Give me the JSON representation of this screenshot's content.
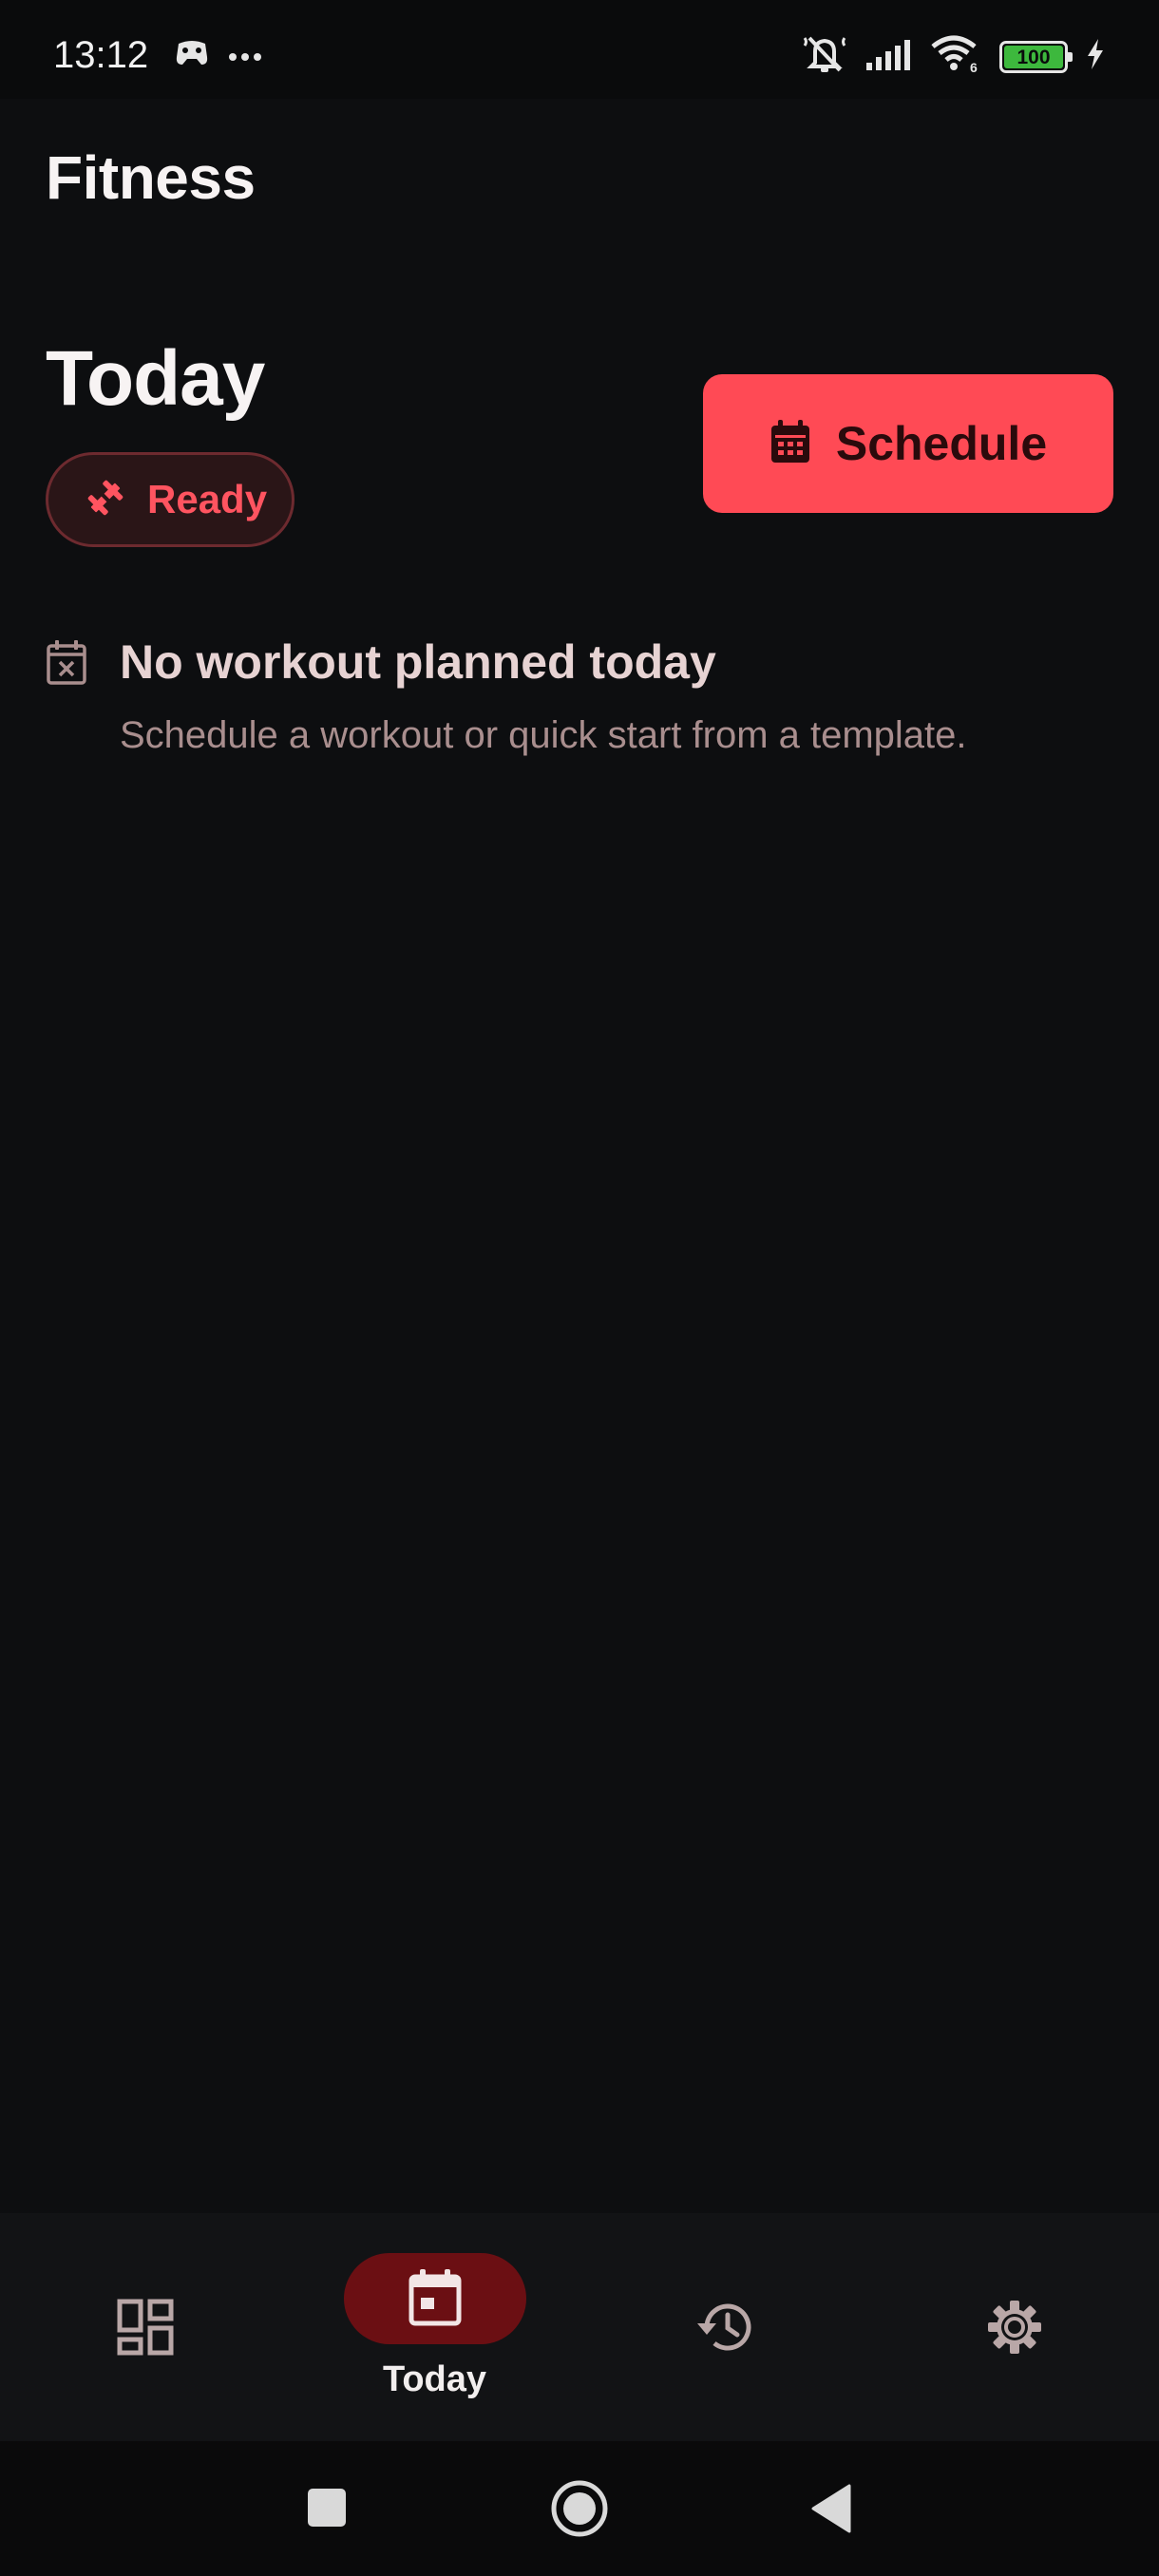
{
  "status_bar": {
    "time": "13:12",
    "battery_level": "100",
    "left_icons": [
      "game-controller-icon",
      "more-dots-icon"
    ],
    "right_icons": [
      "notifications-muted-icon",
      "cellular-signal-icon",
      "wifi-6-icon",
      "battery-icon",
      "charging-bolt-icon"
    ],
    "battery_color": "#3db83d"
  },
  "app": {
    "title": "Fitness"
  },
  "today": {
    "title": "Today",
    "status_chip": {
      "label": "Ready",
      "icon": "dumbbell-icon"
    },
    "schedule_button": {
      "label": "Schedule",
      "icon": "calendar-icon"
    },
    "empty_state": {
      "icon": "calendar-x-icon",
      "title": "No workout planned today",
      "subtitle": "Schedule a workout or quick start from a template."
    }
  },
  "bottom_nav": {
    "items": [
      {
        "id": "dashboard",
        "icon": "dashboard-grid-icon",
        "label": "",
        "active": false
      },
      {
        "id": "today",
        "icon": "calendar-today-icon",
        "label": "Today",
        "active": true
      },
      {
        "id": "history",
        "icon": "history-icon",
        "label": "",
        "active": false
      },
      {
        "id": "settings",
        "icon": "gear-icon",
        "label": "",
        "active": false
      }
    ]
  },
  "system_nav": {
    "buttons": [
      "recents-square-icon",
      "home-circle-icon",
      "back-triangle-icon"
    ]
  },
  "colors": {
    "background": "#0d0e10",
    "accent": "#ff4a55",
    "accent_text": "#ff5460",
    "nav_active_pill": "#6b0f13",
    "empty_title": "#e7d3d3",
    "empty_subtitle": "#a98e8e"
  }
}
